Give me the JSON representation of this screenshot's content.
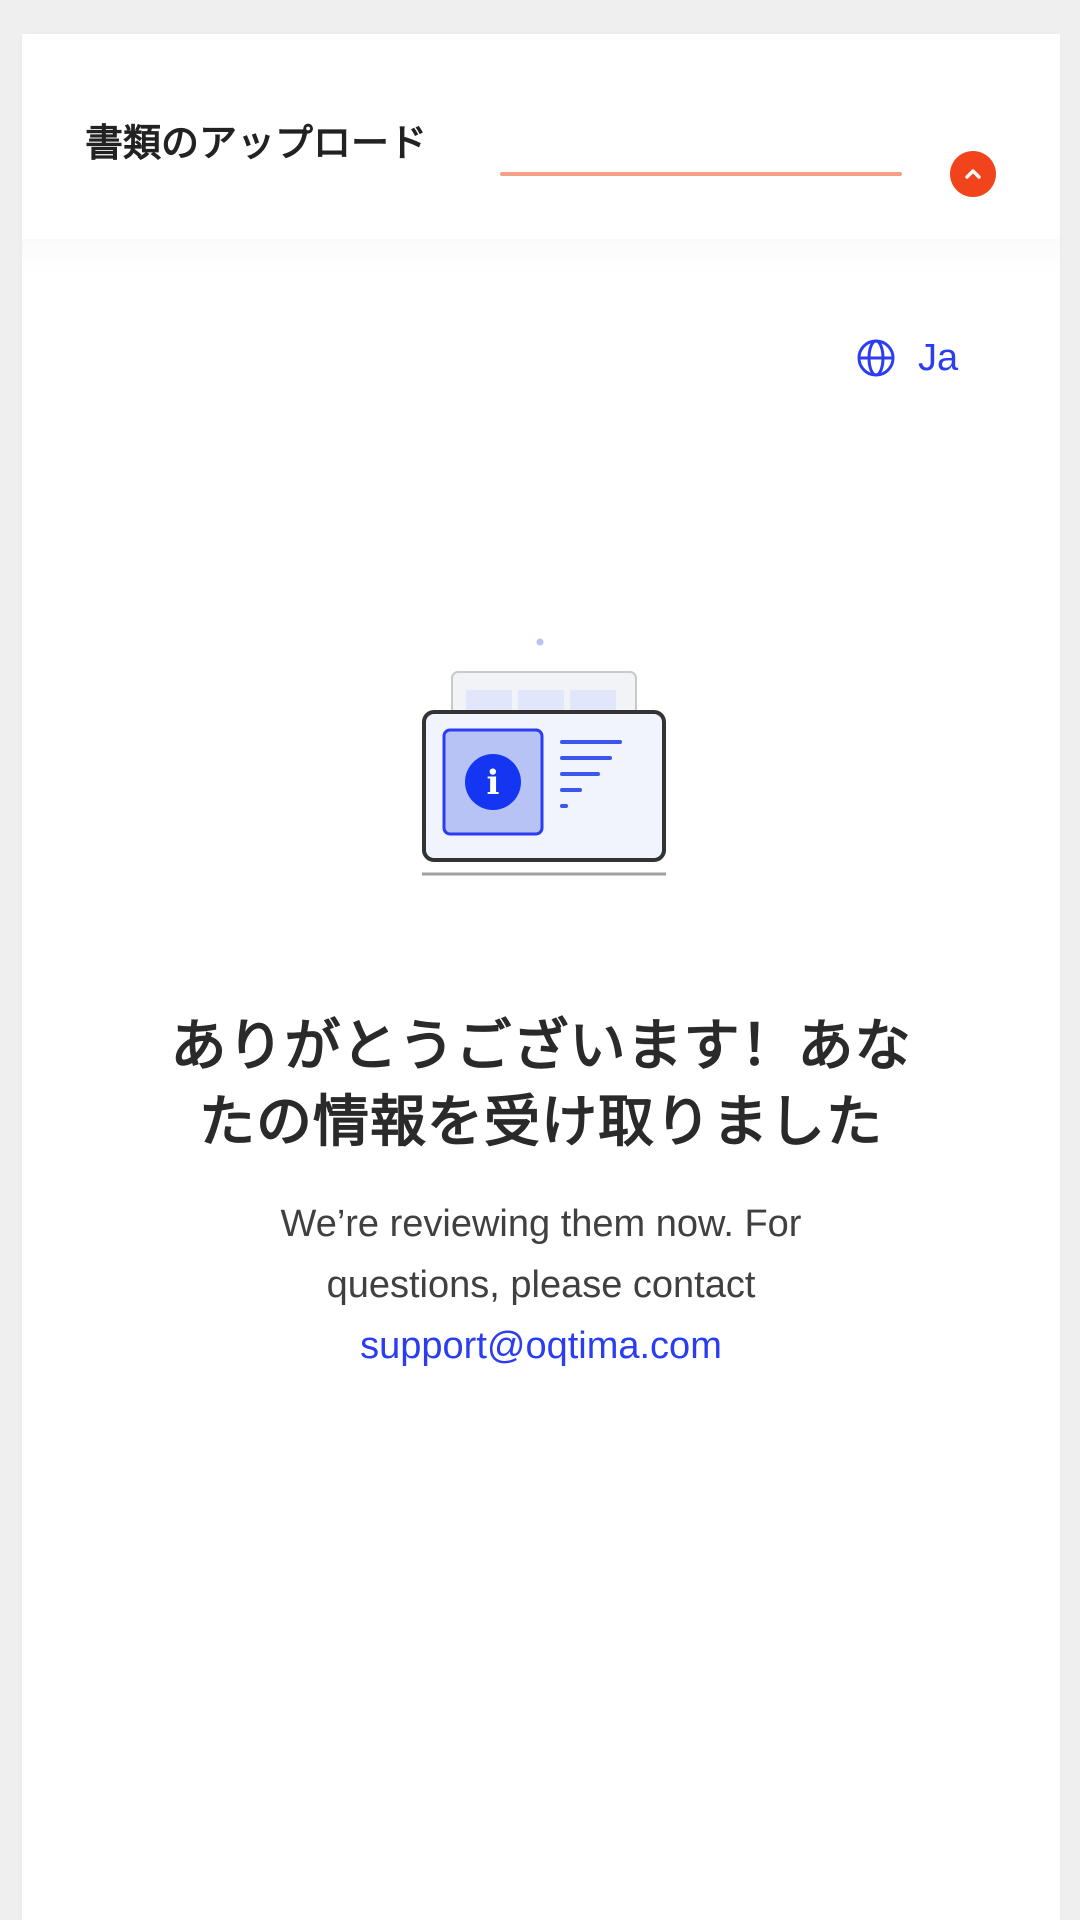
{
  "header": {
    "title": "書類のアップロード",
    "collapse_icon": "chevron-up-icon",
    "accent_color": "#f2441c"
  },
  "language": {
    "icon": "globe-icon",
    "label": "Ja",
    "color": "#2b3df0"
  },
  "illustration": {
    "icon": "info-icon",
    "glyph": "i"
  },
  "content": {
    "heading_line1": "ありがとうございます！あな",
    "heading_line2": "たの情報を受け取りました",
    "body_line1": "We’re reviewing them now. For",
    "body_line2": "questions, please contact",
    "support_email": "support@oqtima.com"
  }
}
